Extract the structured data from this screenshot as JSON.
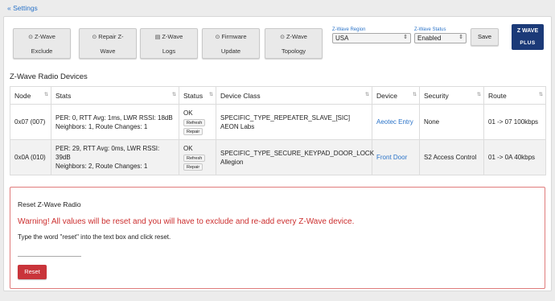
{
  "nav": {
    "back_label": "« Settings"
  },
  "toolbar": {
    "buttons": [
      {
        "line1": "Z-Wave",
        "line2": "Exclude",
        "icon": "circle-icon"
      },
      {
        "line1": "Repair Z-",
        "line2": "Wave",
        "icon": "circle-icon"
      },
      {
        "line1": "Z-Wave",
        "line2": "Logs",
        "icon": "document-icon"
      },
      {
        "line1": "Firmware",
        "line2": "Update",
        "icon": "circle-icon"
      },
      {
        "line1": "Z-Wave",
        "line2": "Topology",
        "icon": "circle-icon"
      }
    ],
    "region": {
      "label": "Z-Wave Region",
      "value": "USA"
    },
    "status": {
      "label": "Z-Wave Status",
      "value": "Enabled"
    },
    "save_label": "Save",
    "logo": {
      "top": "Z WAVE",
      "bottom": "PLUS"
    }
  },
  "devices": {
    "title": "Z-Wave Radio Devices",
    "columns": [
      "Node",
      "Stats",
      "Status",
      "Device Class",
      "Device",
      "Security",
      "Route"
    ],
    "rows": [
      {
        "node": "0x07 (007)",
        "stats_line1": "PER: 0, RTT Avg: 1ms, LWR RSSI: 18dB",
        "stats_line2": "Neighbors: 1, Route Changes: 1",
        "status": "OK",
        "refresh": "Refresh",
        "repair": "Repair",
        "class_line1": "SPECIFIC_TYPE_REPEATER_SLAVE_[SIC]",
        "class_line2": "AEON Labs",
        "device": "Aeotec Entry",
        "security": "None",
        "route": "01 -> 07 100kbps"
      },
      {
        "node": "0x0A (010)",
        "stats_line1": "PER: 29, RTT Avg: 0ms, LWR RSSI: 39dB",
        "stats_line2": "Neighbors: 2, Route Changes: 1",
        "status": "OK",
        "refresh": "Refresh",
        "repair": "Repair",
        "class_line1": "SPECIFIC_TYPE_SECURE_KEYPAD_DOOR_LOCK",
        "class_line2": "Allegion",
        "device": "Front Door",
        "security": "S2 Access Control",
        "route": "01 -> 0A 40kbps"
      }
    ]
  },
  "reset": {
    "title": "Reset Z-Wave Radio",
    "warning": "Warning! All values will be reset and you will have to exclude and re-add every Z-Wave device.",
    "instructions": "Type the word \"reset\" into the text box and click reset.",
    "input_value": "",
    "button_label": "Reset"
  },
  "colors": {
    "accent": "#2a73c8",
    "danger": "#c9343a",
    "warning_text": "#cc2f2f",
    "logo_bg": "#1b3a78"
  }
}
